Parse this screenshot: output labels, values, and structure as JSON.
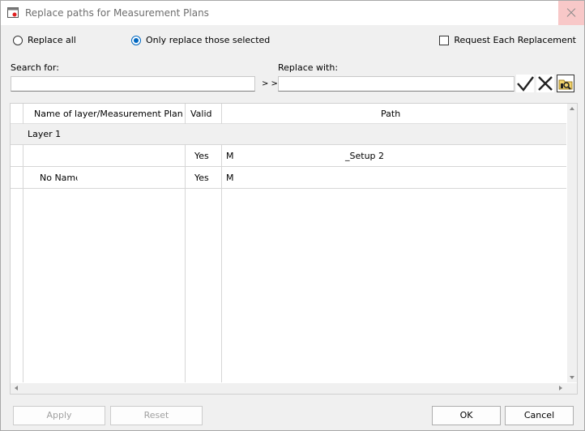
{
  "window": {
    "title": "Replace paths for Measurement Plans"
  },
  "options": {
    "replace_all": "Replace all",
    "only_selected": "Only replace those selected",
    "selected_mode": "only_selected",
    "request_each": "Request Each Replacement",
    "request_each_checked": false
  },
  "search": {
    "label": "Search for:",
    "value": "",
    "arrows": "> >"
  },
  "replace": {
    "label": "Replace with:",
    "value": ""
  },
  "grid": {
    "columns": [
      "Name of layer/Measurement Plan",
      "Valid",
      "Path"
    ],
    "group": "Layer 1",
    "rows": [
      {
        "name": "",
        "valid": "Yes",
        "path_start": "M",
        "path_end": "_Setup 2"
      },
      {
        "name": "No Name",
        "valid": "Yes",
        "path_start": "M",
        "path_end": ""
      }
    ]
  },
  "buttons": {
    "apply": "Apply",
    "reset": "Reset",
    "ok": "OK",
    "cancel": "Cancel"
  },
  "colors": {
    "accent": "#0067c0",
    "close_hover": "#f8c8c8"
  }
}
